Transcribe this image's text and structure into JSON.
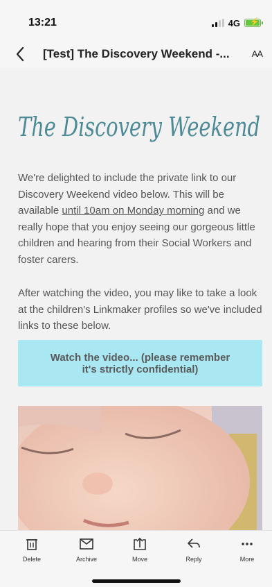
{
  "status_bar": {
    "time": "13:21",
    "network": "4G",
    "signal_bars": 2,
    "battery_level": 1.0
  },
  "header": {
    "subject": "[Test] The Discovery Weekend -...",
    "font_size_label": "AA"
  },
  "email": {
    "script_title": "The Discovery Weekend",
    "para1_before": "We're delighted to include the private link to our Discovery Weekend video below. This will be available ",
    "para1_underlined": "until 10am on Monday morning",
    "para1_after": " and we really hope that you enjoy seeing our gorgeous little children and hearing from their Social Workers and foster carers.",
    "para2": "After watching the video, you may like to take a look at the children's Linkmaker profiles so we've included links to these below.",
    "cta_label": "Watch the video... (please remember it's strictly confidential)"
  },
  "toolbar": {
    "items": [
      {
        "label": "Delete",
        "icon": "trash-icon"
      },
      {
        "label": "Archive",
        "icon": "archive-icon"
      },
      {
        "label": "Move",
        "icon": "move-icon"
      },
      {
        "label": "Reply",
        "icon": "reply-icon"
      },
      {
        "label": "More",
        "icon": "more-icon"
      }
    ]
  },
  "colors": {
    "accent_teal": "#4c8a96",
    "cta_background": "#a9e7f2",
    "battery_green": "#62c83a"
  }
}
